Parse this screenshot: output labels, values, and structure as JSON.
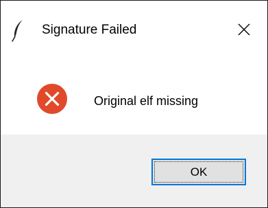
{
  "window": {
    "title": "Signature Failed",
    "app_icon": "feather-icon",
    "close_icon": "close-icon"
  },
  "dialog": {
    "icon": "error-icon",
    "message": "Original elf missing"
  },
  "buttons": {
    "ok_label": "OK"
  },
  "colors": {
    "error_red": "#e04a2a",
    "focus_border": "#0078d7",
    "button_face": "#e1e1e1",
    "footer_background": "#f0f0f0"
  }
}
